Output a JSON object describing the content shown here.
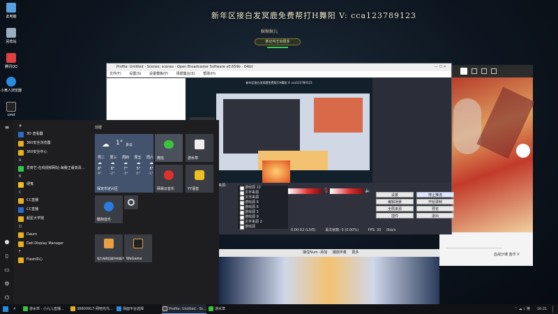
{
  "stream": {
    "banner": "新年区接白发冥鹿免费帮打H舞阳  V: cca123789123",
    "name": "秋秋秋儿",
    "badge": "新记叫王出很多"
  },
  "desktop_icons": [
    {
      "label": "此电脑",
      "color": "#5aa0e0"
    },
    {
      "label": "回收站",
      "color": "#9ab0c0"
    },
    {
      "label": "腾讯QQ",
      "color": "#e04040"
    },
    {
      "label": "小黄人浏览器",
      "color": "#2a8ae0"
    },
    {
      "label": "cmd",
      "color": "#222222"
    }
  ],
  "obs": {
    "title": "Profile: Untitled - Scenes: scenes - Open Broadcaster Software v0.659b - 64bit",
    "menu": [
      "文件(F)",
      "设置(S)",
      "设置模板(P)",
      "场景集合(S)",
      "帮助(H)"
    ],
    "preview_caption": "新年区接白发冥鹿免费帮打H舞阳  V: cca123789123",
    "scenes_label": "来源:",
    "sources": [
      "游戏源 10",
      "文字来源",
      "文字来源",
      "游戏源 6",
      "游戏源 6",
      "游戏源 5",
      "游戏源 9",
      "文字来源 2",
      "游戏源",
      "游戏源 7"
    ],
    "buttons": {
      "settings": "设置",
      "stop_stream": "停止推流",
      "edit_scene": "编辑场景",
      "start_record": "开始录制",
      "global_sources": "全局来源",
      "preview": "预览",
      "plugins": "插件",
      "exit": "退出"
    },
    "status": {
      "time": "0:00:02 (LIVE)",
      "dropped": "丢失帧数: 0 (0.00%)",
      "fps": "FPS: 30",
      "kbps": "0kb/s"
    }
  },
  "mini_bar": {
    "items": [
      "接住Num -添加",
      "播放伴奏",
      "更多"
    ]
  },
  "start_menu": {
    "tiles_header": "创建",
    "apps": [
      {
        "type": "letter",
        "text": "#"
      },
      {
        "type": "app",
        "text": "3D 查看器",
        "color": "#2a6bd0"
      },
      {
        "type": "app",
        "text": "360安全浏览器",
        "color": "#e8b020"
      },
      {
        "type": "app",
        "text": "360安全中心",
        "color": "#e8b020"
      },
      {
        "type": "letter",
        "text": "A"
      },
      {
        "type": "app",
        "text": "爱奇艺-在线视频网站-海量正版高清...",
        "color": "#2ec84a"
      },
      {
        "type": "letter",
        "text": "B"
      },
      {
        "type": "app",
        "text": "便笺",
        "color": "#f0c020"
      },
      {
        "type": "letter",
        "text": "C"
      },
      {
        "type": "app",
        "text": "CC直播",
        "color": "#e8b020"
      },
      {
        "type": "app",
        "text": "CC直播",
        "color": "#2a6bd0"
      },
      {
        "type": "app",
        "text": "超星大学馆",
        "color": "#e8b020"
      },
      {
        "type": "letter",
        "text": "D"
      },
      {
        "type": "app",
        "text": "Daum",
        "color": "#e8b020"
      },
      {
        "type": "app",
        "text": "Dell Display Manager",
        "color": "#e8b020"
      },
      {
        "type": "letter",
        "text": "F"
      },
      {
        "type": "app",
        "text": "Flash中心",
        "color": "#e8b020"
      }
    ],
    "weather": {
      "temp": "1°",
      "cond": "多云",
      "days": [
        "周二",
        "周三",
        "周四",
        "周五",
        "周六"
      ],
      "highs": [
        "8°",
        "8°",
        "7°",
        "5°",
        "8°"
      ],
      "lows": [
        "4°",
        "-2°",
        "-3°",
        "0°",
        "-1°"
      ],
      "city": "保定市定兴区"
    },
    "tiles": [
      {
        "key": "wechat",
        "label": "微信",
        "color": "#3a3d44"
      },
      {
        "key": "water",
        "label": "游水草",
        "color": "#3a3d44"
      },
      {
        "key": "netease",
        "label": "网易云音乐",
        "color": "#3a3d44"
      },
      {
        "key": "yy",
        "label": "YY语音",
        "color": "#3a3d44"
      },
      {
        "key": "kugou",
        "label": "酷狗音乐",
        "color": "#3a3d44"
      },
      {
        "key": "steam",
        "label": "",
        "color": "#3a3d44"
      },
      {
        "key": "assistant",
        "label": "强力海帮回顾中的助手",
        "color": "#3a3d44"
      },
      {
        "key": "wegame",
        "label": "WeGame",
        "color": "#3a3d44"
      }
    ]
  },
  "taskbar": {
    "items": [
      "游水草 - 小九儿直播...",
      "38800917 网吧先代...",
      "场面平台选择",
      "Profile: Untitled - Sc...",
      "游水草"
    ],
    "clock": "10:21"
  },
  "game": {
    "bottom_text": "血战沙滩  金币  V"
  }
}
